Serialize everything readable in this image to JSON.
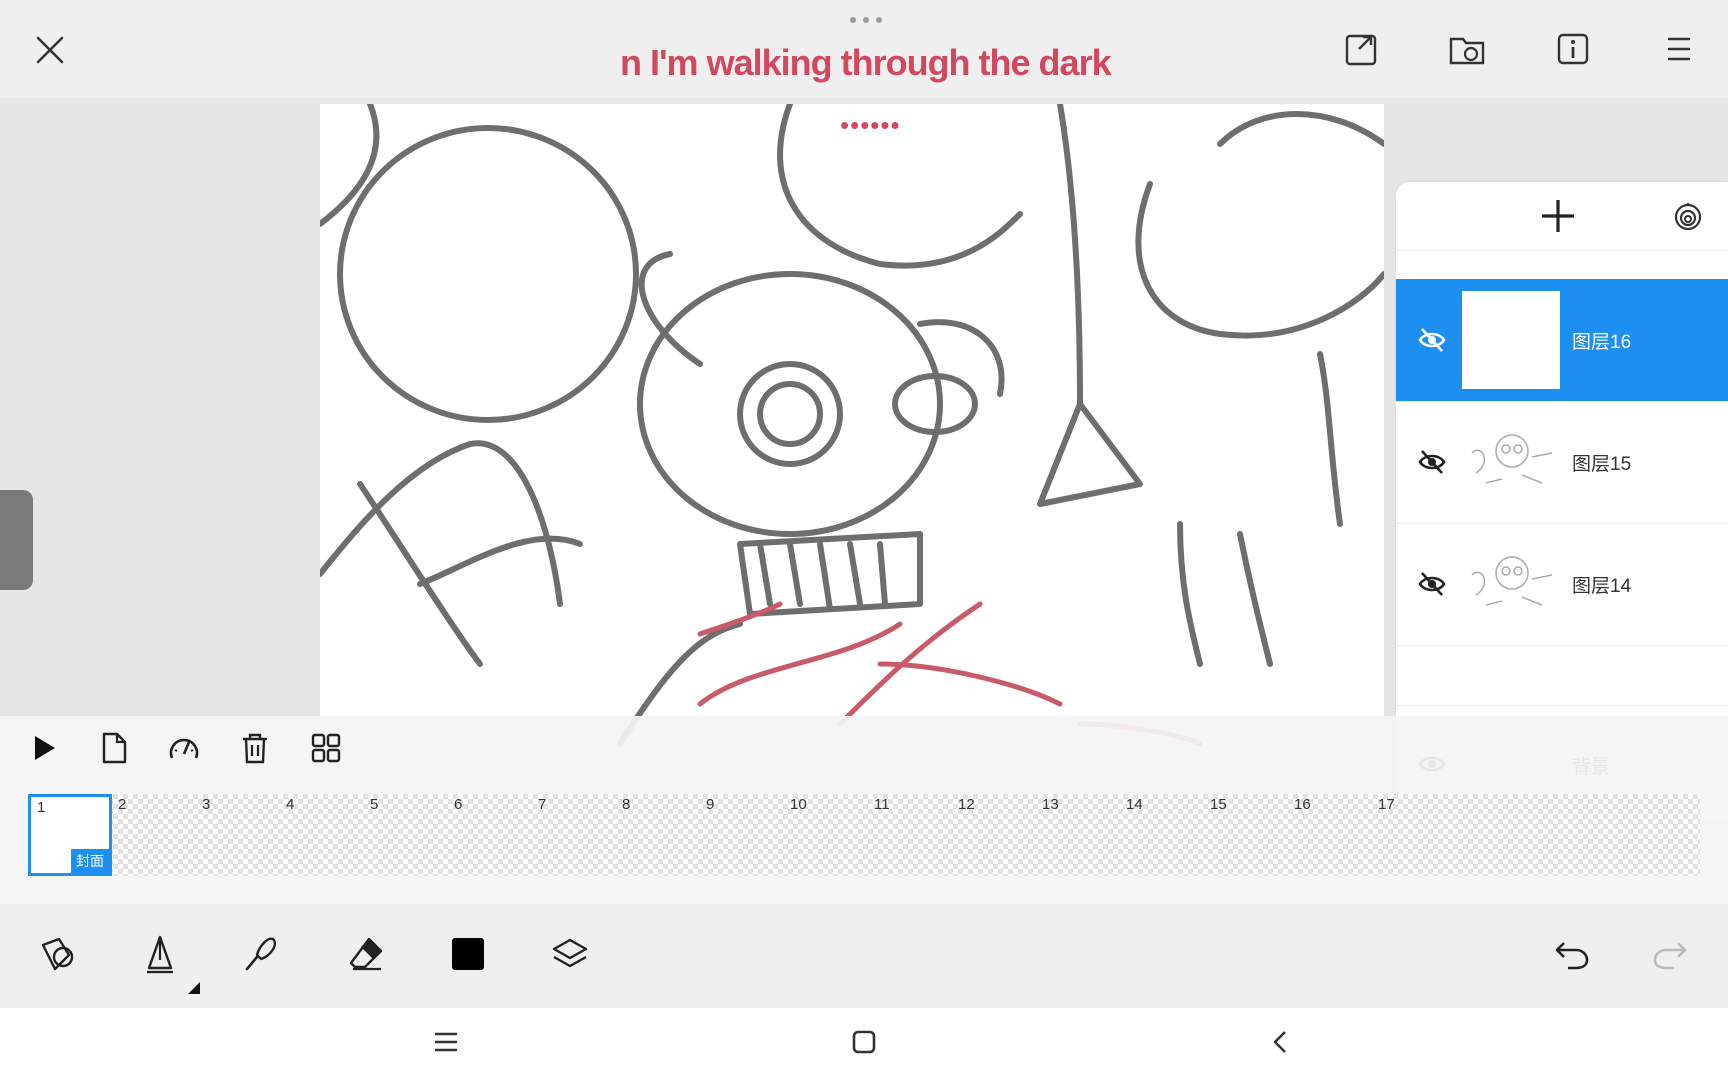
{
  "app": {
    "song_title": "n I'm walking through the dark",
    "canvas_dots": "••••••"
  },
  "layers": {
    "items": [
      {
        "name": "图层16",
        "visible": false,
        "active": true
      },
      {
        "name": "图层15",
        "visible": false,
        "active": false
      },
      {
        "name": "图层14",
        "visible": false,
        "active": false
      }
    ],
    "background": {
      "name": "背景",
      "visible": true
    }
  },
  "timeline": {
    "frames": [
      "1",
      "2",
      "3",
      "4",
      "5",
      "6",
      "7",
      "8",
      "9",
      "10",
      "11",
      "12",
      "13",
      "14",
      "15",
      "16",
      "17"
    ],
    "selected_frame": "1",
    "cover_label": "封面"
  },
  "icons": {
    "top": [
      "close-icon",
      "export-icon",
      "open-folder-icon",
      "info-icon",
      "menu-icon"
    ],
    "timeline": [
      "play-icon",
      "new-frame-icon",
      "speed-icon",
      "delete-icon",
      "grid-icon"
    ],
    "toolbar": [
      "shapes-icon",
      "pen-icon",
      "brush-icon",
      "eraser-icon",
      "color-swatch",
      "layers-icon",
      "undo-icon",
      "redo-icon"
    ],
    "nav": [
      "recent-apps-icon",
      "home-icon",
      "back-icon"
    ]
  },
  "colors": {
    "accent": "#1c8ff0",
    "song": "#d2485f",
    "current_color": "#000000"
  }
}
